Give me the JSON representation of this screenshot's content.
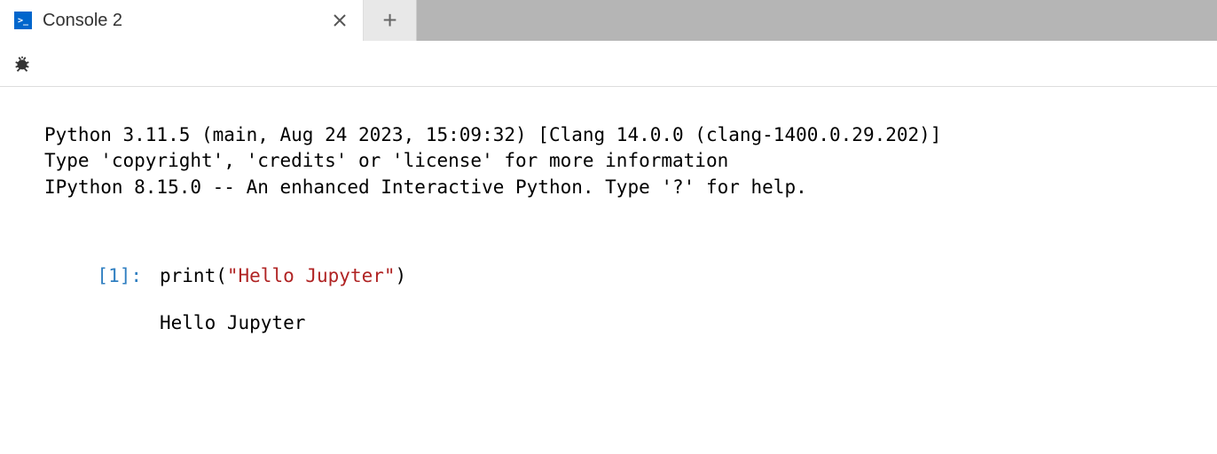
{
  "tab": {
    "title": "Console 2"
  },
  "banner": {
    "line1": "Python 3.11.5 (main, Aug 24 2023, 15:09:32) [Clang 14.0.0 (clang-1400.0.29.202)]",
    "line2": "Type 'copyright', 'credits' or 'license' for more information",
    "line3": "IPython 8.15.0 -- An enhanced Interactive Python. Type '?' for help."
  },
  "cell": {
    "prompt": "[1]:",
    "code_fn": "print",
    "code_paren_open": "(",
    "code_string": "\"Hello Jupyter\"",
    "code_paren_close": ")",
    "output": "Hello Jupyter"
  }
}
